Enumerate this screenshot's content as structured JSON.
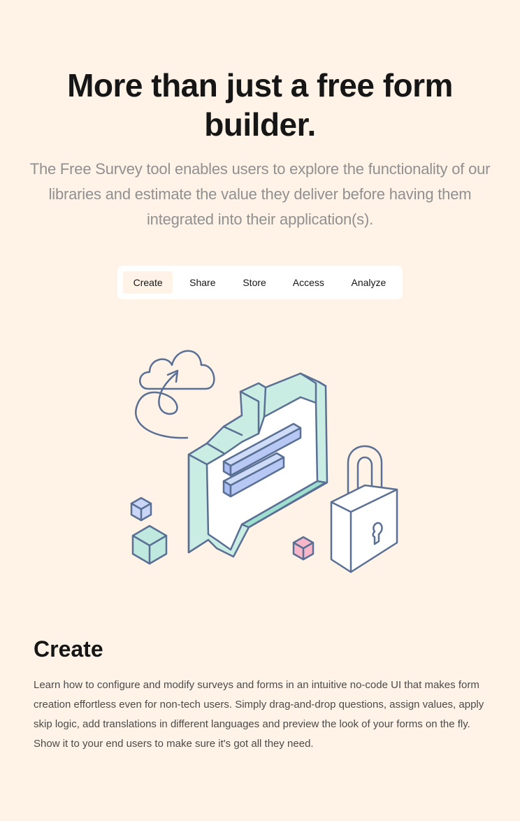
{
  "hero": {
    "title": "More than just a free form builder.",
    "subtitle": "The Free Survey tool enables users to explore the functionality of our libraries and estimate the value they deliver before having them integrated into their application(s)."
  },
  "tabs": [
    {
      "label": "Create",
      "active": true
    },
    {
      "label": "Share",
      "active": false
    },
    {
      "label": "Store",
      "active": false
    },
    {
      "label": "Access",
      "active": false
    },
    {
      "label": "Analyze",
      "active": false
    }
  ],
  "section": {
    "title": "Create",
    "body": "Learn how to configure and modify surveys and forms in an intuitive no-code UI that makes form creation effortless even for non-tech users. Simply drag-and-drop questions, assign values, apply skip logic, add translations in different languages and preview the look of your forms on the fly. Show it to your end users to make sure it's got all they need."
  },
  "colors": {
    "background": "#fff3e7",
    "accent_teal": "#bfe9df",
    "accent_blue": "#a9bdf2",
    "accent_pink": "#f7b7c9",
    "outline": "#5a6f94"
  },
  "icons": {
    "cloud": "cloud-icon",
    "chat": "chat-bubble-icon",
    "lock": "padlock-icon",
    "cube": "cube-icon"
  }
}
